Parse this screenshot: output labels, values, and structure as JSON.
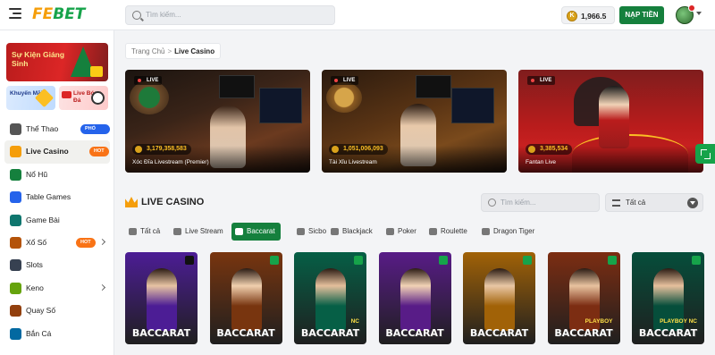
{
  "header": {
    "logo_fe": "FE",
    "logo_bet": "BET",
    "search_placeholder": "Tìm kiếm...",
    "balance": "1,966.5",
    "coin_symbol": "K",
    "deposit_label": "NẠP TIỀN"
  },
  "sidebar": {
    "promo_big": "Sự Kiện Giáng Sinh",
    "promo_small_1": "Khuyến Mãi",
    "promo_small_2": "Live Bóng Đá",
    "items": [
      {
        "label": "Thể Thao",
        "badge": "PHỔ BIẾN",
        "icon": "soccer-ball-icon",
        "color": "#555555"
      },
      {
        "label": "Live Casino",
        "badge": "HOT",
        "icon": "crown-icon",
        "color": "#f59e0b",
        "active": true
      },
      {
        "label": "Nổ Hũ",
        "badge": "",
        "icon": "jackpot-icon",
        "color": "#15803d"
      },
      {
        "label": "Table Games",
        "badge": "",
        "icon": "table-games-icon",
        "color": "#2563eb"
      },
      {
        "label": "Game Bài",
        "badge": "",
        "icon": "cards-icon",
        "color": "#0f766e"
      },
      {
        "label": "Xổ Số",
        "badge": "HOT",
        "icon": "lottery-icon",
        "color": "#b45309",
        "chevron": true
      },
      {
        "label": "Slots",
        "badge": "",
        "icon": "slots-icon",
        "color": "#374151"
      },
      {
        "label": "Keno",
        "badge": "",
        "icon": "keno-icon",
        "color": "#65a30d",
        "chevron": true
      },
      {
        "label": "Quay Số",
        "badge": "",
        "icon": "spin-wheel-icon",
        "color": "#92400e"
      },
      {
        "label": "Bắn Cá",
        "badge": "",
        "icon": "fish-icon",
        "color": "#0369a1"
      }
    ]
  },
  "breadcrumb": {
    "home": "Trang Chủ",
    "separator": ">",
    "current": "Live Casino"
  },
  "banners": [
    {
      "jackpot": "3,179,358,583",
      "name": "Xóc Đĩa Livestream (Premier)",
      "live": "LIVE"
    },
    {
      "jackpot": "1,051,006,093",
      "name": "Tài Xỉu Livestream",
      "live": "LIVE"
    },
    {
      "jackpot": "3,385,534",
      "name": "Fantan Live",
      "live": "LIVE"
    }
  ],
  "section": {
    "title": "LIVE CASINO",
    "search_placeholder": "Tìm kiếm...",
    "filter_value": "Tất cả"
  },
  "tabs": [
    {
      "label": "Tất cả",
      "icon": "all-icon"
    },
    {
      "label": "Live Stream",
      "icon": "live-stream-icon"
    },
    {
      "label": "Baccarat",
      "icon": "baccarat-icon",
      "active": true
    },
    {
      "label": "Sicbo",
      "icon": "sicbo-icon"
    },
    {
      "label": "Blackjack",
      "icon": "blackjack-icon"
    },
    {
      "label": "Poker",
      "icon": "poker-icon"
    },
    {
      "label": "Roulette",
      "icon": "roulette-icon"
    },
    {
      "label": "Dragon Tiger",
      "icon": "dragon-tiger-icon"
    }
  ],
  "cards": [
    {
      "title": "BACCARAT",
      "sub": "",
      "bg": "#4c1d95"
    },
    {
      "title": "BACCARAT",
      "sub": "",
      "bg": "#78350f"
    },
    {
      "title": "BACCARAT",
      "sub": "NC",
      "bg": "#065f46"
    },
    {
      "title": "BACCARAT",
      "sub": "",
      "bg": "#581c87"
    },
    {
      "title": "BACCARAT",
      "sub": "",
      "bg": "#a16207"
    },
    {
      "title": "BACCARAT",
      "sub": "PLAYBOY",
      "bg": "#7c2d12"
    },
    {
      "title": "BACCARAT",
      "sub": "PLAYBOY NC",
      "bg": "#064e3b"
    }
  ]
}
